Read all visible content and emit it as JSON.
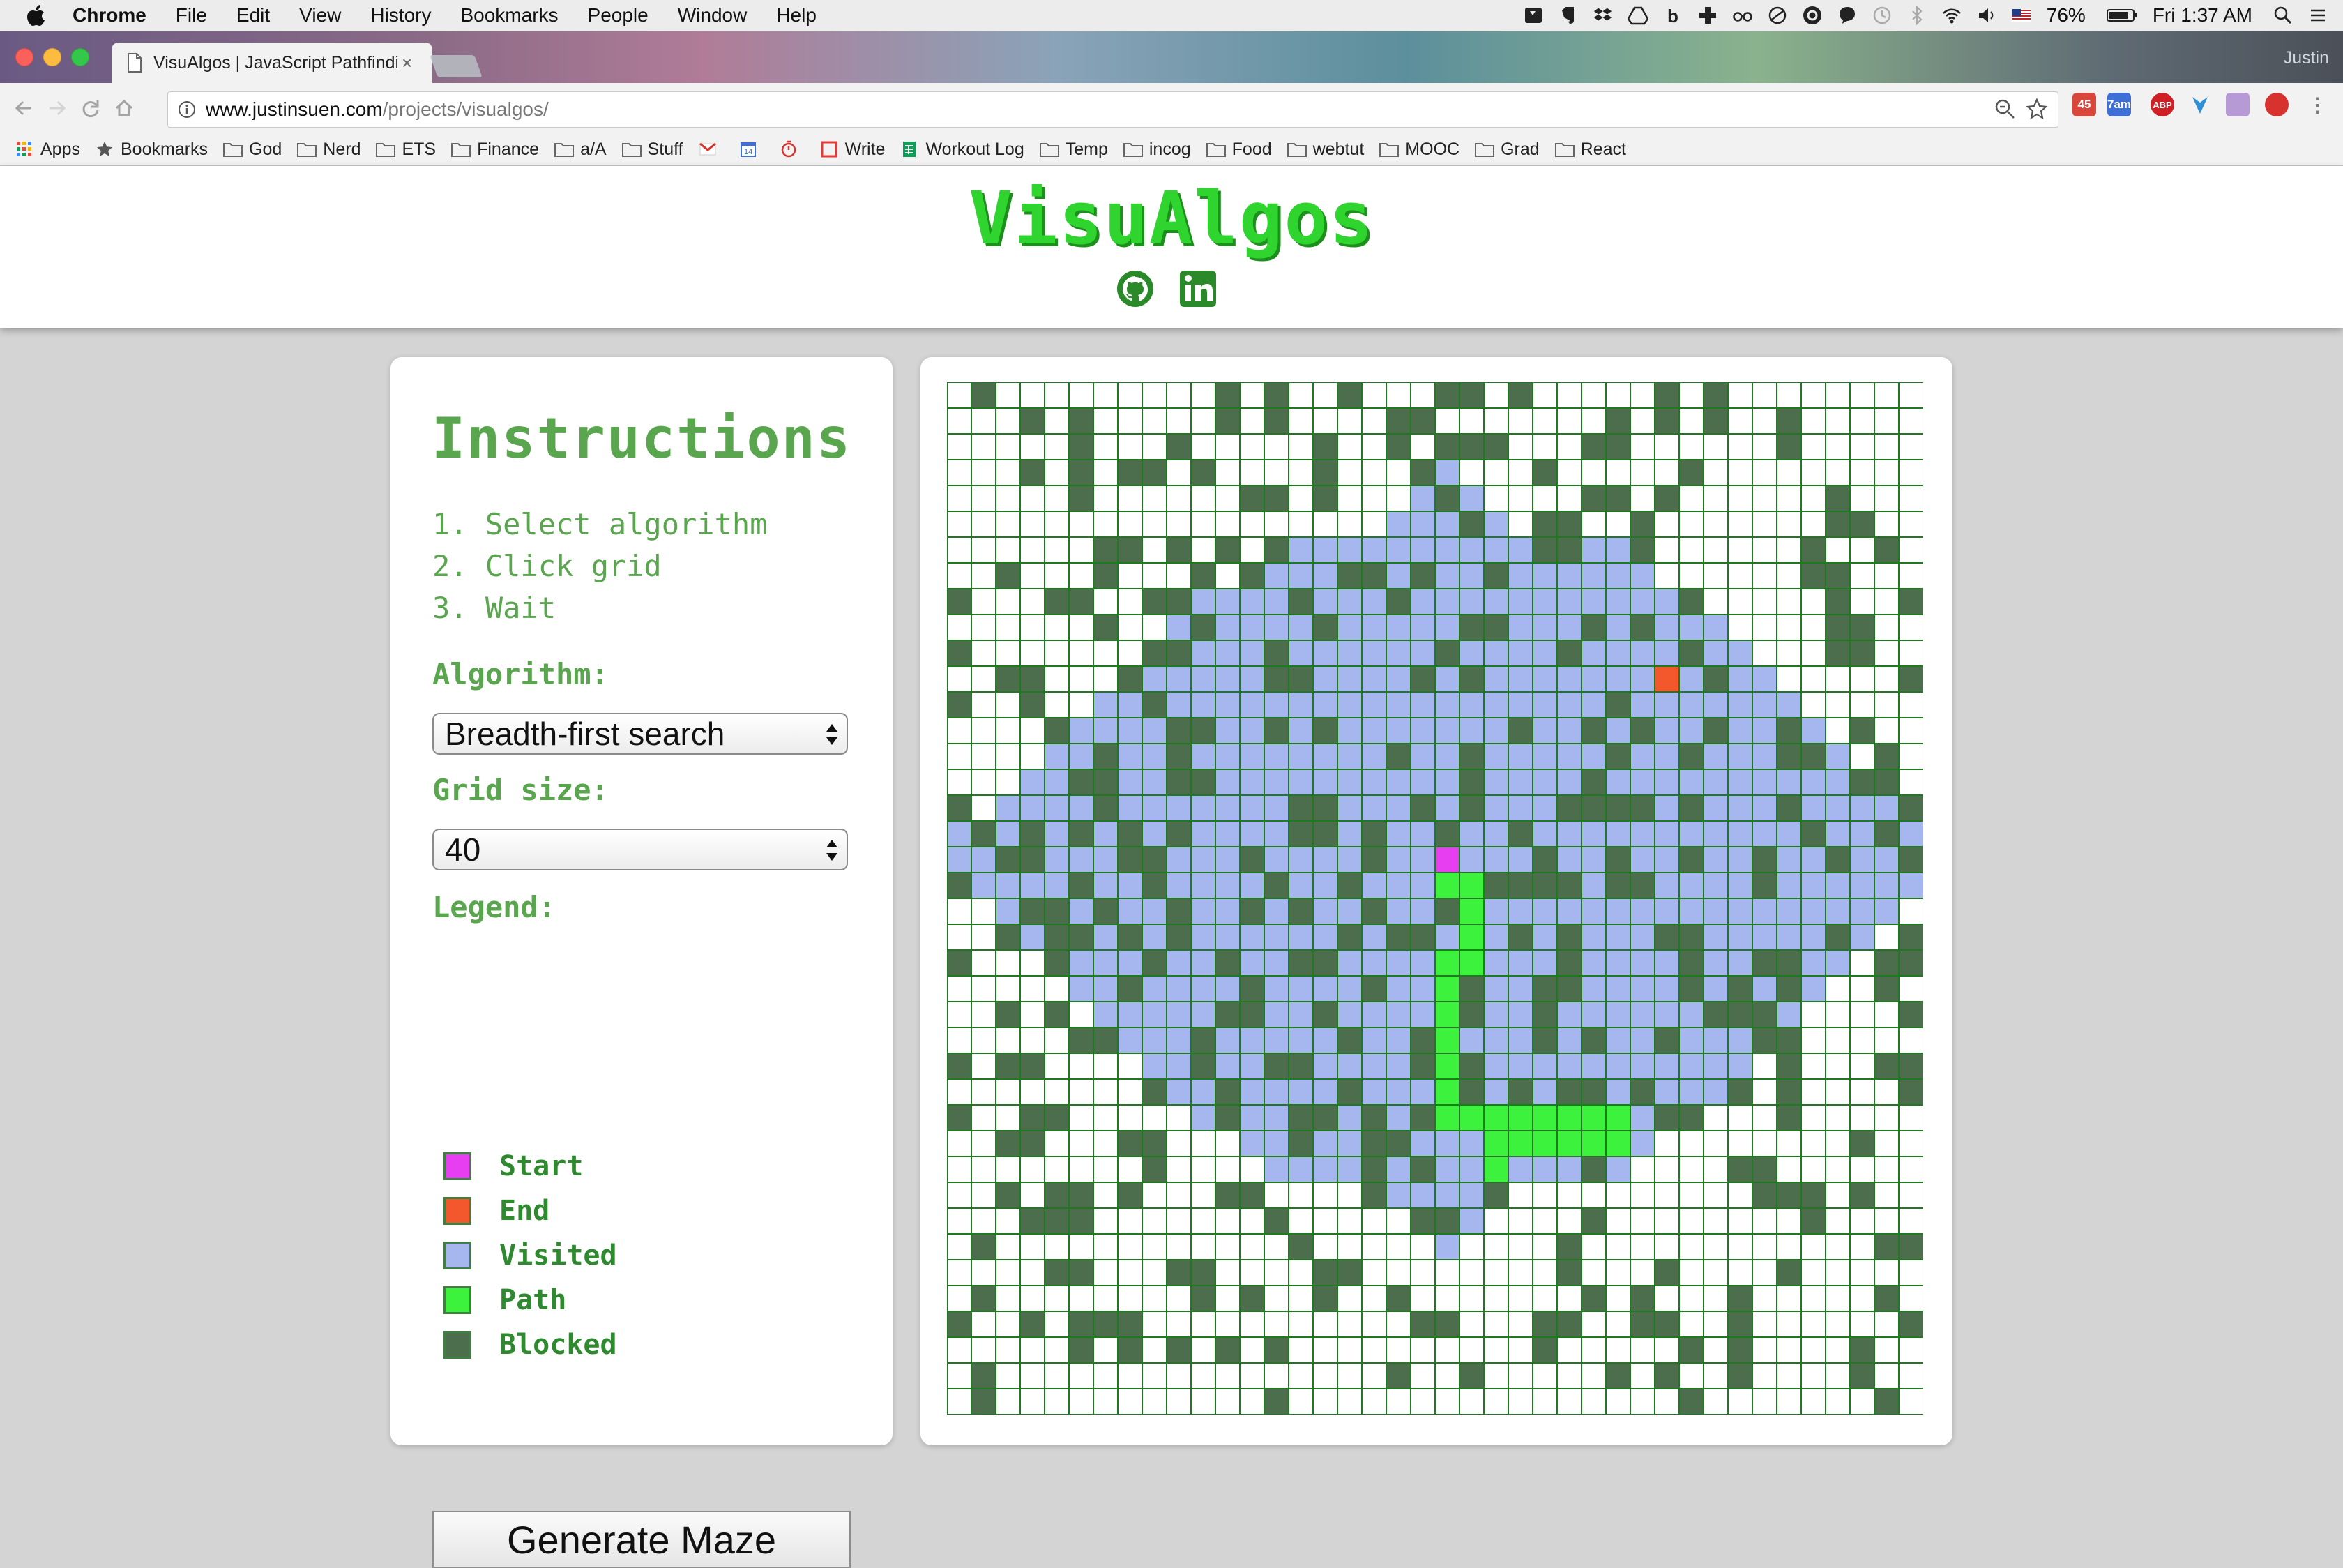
{
  "menubar": {
    "app": "Chrome",
    "items": [
      "File",
      "Edit",
      "View",
      "History",
      "Bookmarks",
      "People",
      "Window",
      "Help"
    ],
    "battery": "76%",
    "clock": "Fri 1:37 AM",
    "icons": [
      "screencast-icon",
      "evernote-icon",
      "dropbox-icon",
      "drive-icon",
      "b-icon",
      "cross-icon",
      "glasses-icon",
      "circle-icon",
      "creative-cloud-icon",
      "chat-icon",
      "time-machine-icon",
      "bluetooth-icon",
      "wifi-icon",
      "volume-icon",
      "us-flag-icon",
      "battery-icon",
      "search-icon",
      "list-icon"
    ]
  },
  "browser": {
    "tab_title": "VisuAlgos | JavaScript Pathfinding",
    "tab_close": "×",
    "profile": "Justin",
    "url_host": "www.justinsuen.com",
    "url_path": "/projects/visualgos/",
    "extensions": [
      {
        "name": "gmail-extension",
        "badge": "45",
        "color": "#d9473a"
      },
      {
        "name": "calendar-extension",
        "badge": "7am",
        "color": "#3d6fd6"
      },
      {
        "name": "adblock-extension",
        "badge": "ABP",
        "color": "#d01f25"
      },
      {
        "name": "shortcut-extension",
        "badge": "",
        "color": "#2d8fd6"
      },
      {
        "name": "color-extension",
        "badge": "",
        "color": "#b59ad6"
      },
      {
        "name": "record-extension",
        "badge": "",
        "color": "#d8322e"
      }
    ]
  },
  "bookmarks": [
    {
      "label": "Apps",
      "icon": "apps-icon"
    },
    {
      "label": "Bookmarks",
      "icon": "star-icon"
    },
    {
      "label": "God",
      "icon": "folder-icon"
    },
    {
      "label": "Nerd",
      "icon": "folder-icon"
    },
    {
      "label": "ETS",
      "icon": "folder-icon"
    },
    {
      "label": "Finance",
      "icon": "folder-icon"
    },
    {
      "label": "a/A",
      "icon": "folder-icon"
    },
    {
      "label": "Stuff",
      "icon": "folder-icon"
    },
    {
      "label": "",
      "icon": "gmail-icon"
    },
    {
      "label": "",
      "icon": "calendar-icon"
    },
    {
      "label": "",
      "icon": "timer-icon"
    },
    {
      "label": "Write",
      "icon": "write-icon"
    },
    {
      "label": "Workout Log",
      "icon": "sheets-icon"
    },
    {
      "label": "Temp",
      "icon": "folder-icon"
    },
    {
      "label": "incog",
      "icon": "folder-icon"
    },
    {
      "label": "Food",
      "icon": "folder-icon"
    },
    {
      "label": "webtut",
      "icon": "folder-icon"
    },
    {
      "label": "MOOC",
      "icon": "folder-icon"
    },
    {
      "label": "Grad",
      "icon": "folder-icon"
    },
    {
      "label": "React",
      "icon": "folder-icon"
    }
  ],
  "site": {
    "title": "VisuAlgos",
    "social": [
      "github-icon",
      "linkedin-icon"
    ]
  },
  "instructions": {
    "heading": "Instructions",
    "steps": [
      "1. Select algorithm",
      "2. Click grid",
      "3. Wait"
    ],
    "algorithm_label": "Algorithm:",
    "algorithm_value": "Breadth-first search",
    "grid_size_label": "Grid size:",
    "grid_size_value": "40",
    "legend_label": "Legend:",
    "legend": [
      {
        "label": "Start",
        "color": "#e63ef0"
      },
      {
        "label": "End",
        "color": "#f2582c"
      },
      {
        "label": "Visited",
        "color": "#a6b6ef"
      },
      {
        "label": "Path",
        "color": "#3df23d"
      },
      {
        "label": "Blocked",
        "color": "#4d6e4d"
      }
    ],
    "generate_button": "Generate Maze"
  },
  "grid": {
    "size": 40,
    "colors": {
      "empty": "#ffffff",
      "visited": "#a6b6ef",
      "path": "#3df23d",
      "blocked": "#4d6e4d",
      "start": "#e63ef0",
      "end": "#f2582c",
      "line": "#1f7a1f"
    },
    "start": [
      18,
      20
    ],
    "end": [
      11,
      29
    ],
    "path": [
      [
        19,
        20
      ],
      [
        19,
        21
      ],
      [
        20,
        21
      ],
      [
        21,
        21
      ],
      [
        22,
        21
      ],
      [
        22,
        20
      ],
      [
        23,
        20
      ],
      [
        24,
        20
      ],
      [
        25,
        20
      ],
      [
        26,
        20
      ],
      [
        27,
        20
      ],
      [
        28,
        20
      ],
      [
        28,
        21
      ],
      [
        28,
        22
      ],
      [
        28,
        23
      ],
      [
        28,
        24
      ],
      [
        28,
        25
      ],
      [
        28,
        26
      ],
      [
        28,
        27
      ],
      [
        29,
        27
      ],
      [
        29,
        26
      ],
      [
        29,
        25
      ],
      [
        29,
        24
      ],
      [
        29,
        23
      ],
      [
        29,
        22
      ],
      [
        30,
        22
      ]
    ],
    "visited_center": [
      18,
      20
    ],
    "visited_radius": 19
  }
}
